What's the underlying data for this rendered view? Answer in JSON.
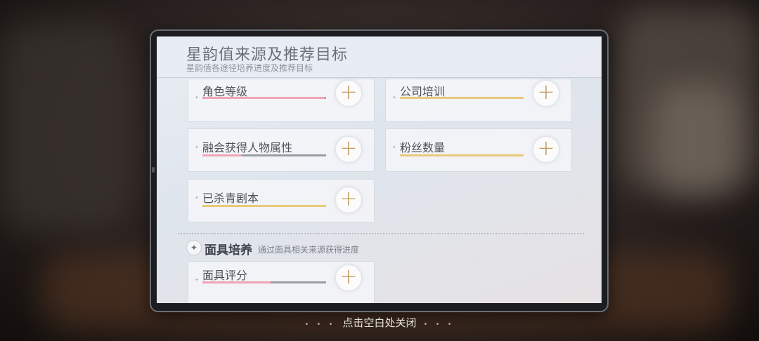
{
  "header": {
    "title": "星韵值来源及推荐目标",
    "subtitle": "星韵值各途径培养进度及推荐目标"
  },
  "cards": [
    {
      "label": "角色等级",
      "progress": 0.99,
      "bar_color": "#f0a5b3"
    },
    {
      "label": "公司培训",
      "progress": 1.0,
      "bar_color": "#e9c97a"
    },
    {
      "label": "融会获得人物属性",
      "progress": 0.32,
      "bar_color": "#f0a5b3"
    },
    {
      "label": "粉丝数量",
      "progress": 1.0,
      "bar_color": "#e9c97a"
    },
    {
      "label": "已杀青剧本",
      "progress": 1.0,
      "bar_color": "#e9c97a"
    }
  ],
  "section": {
    "title": "面具培养",
    "description": "通过面具相关来源获得进度",
    "cards": [
      {
        "label": "面具评分",
        "progress": 0.55,
        "bar_color": "#f0a5b3"
      }
    ]
  },
  "footer": {
    "close_hint": "点击空白处关闭"
  },
  "icons": {
    "plus": "plus-icon",
    "section": "sparkle-icon"
  }
}
